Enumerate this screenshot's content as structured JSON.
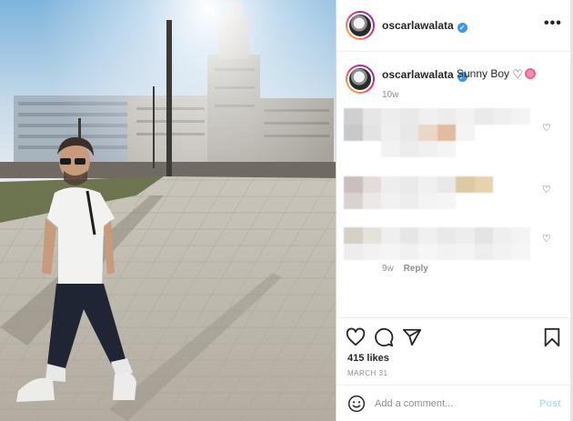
{
  "post": {
    "username": "oscarlawalata",
    "verified": true,
    "caption": "Sunny Boy",
    "caption_emoji": [
      "white-heart",
      "cherry-blossom"
    ],
    "time_ago": "10w",
    "likes": "415 likes",
    "date": "MARCH 31"
  },
  "comments": [
    {
      "blurred": true
    },
    {
      "blurred": true
    },
    {
      "blurred": true,
      "time": "9w",
      "reply_label": "Reply"
    }
  ],
  "comment_bar": {
    "placeholder": "Add a comment...",
    "post_label": "Post"
  },
  "icons": {
    "more": "more-options-icon",
    "like": "heart-icon",
    "comment": "comment-icon",
    "share": "share-icon",
    "save": "bookmark-icon",
    "emoji": "emoji-icon"
  },
  "colors": {
    "verified": "#3897f0",
    "post_disabled": "#b2dffc",
    "secondary_text": "#8e8e8e"
  }
}
